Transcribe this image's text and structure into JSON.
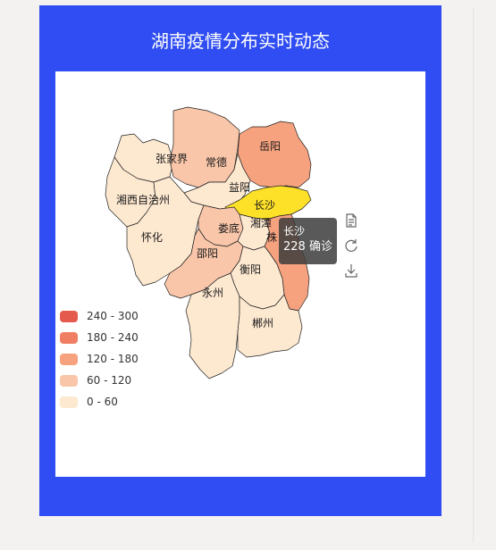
{
  "header": {
    "title": "湖南疫情分布实时动态"
  },
  "colors": {
    "card": "#2f4df2",
    "highlight": "#fde028"
  },
  "legend": {
    "items": [
      {
        "label": "240 - 300",
        "color": "#e45b4d"
      },
      {
        "label": "180 - 240",
        "color": "#ef7e62"
      },
      {
        "label": "120 - 180",
        "color": "#f6a27f"
      },
      {
        "label": "60 - 120",
        "color": "#f9c6a9"
      },
      {
        "label": "0 - 60",
        "color": "#fde8d0"
      }
    ]
  },
  "map": {
    "cities": {
      "zhangjiajie": "张家界",
      "changde": "常德",
      "yueyang": "岳阳",
      "yiyang": "益阳",
      "xiangxi": "湘西自治州",
      "changsha": "长沙",
      "huaihua": "怀化",
      "loudi": "娄底",
      "xiangtan": "湘潭",
      "zhuzhou": "株",
      "shaoyang": "邵阳",
      "hengyang": "衡阳",
      "yongzhou": "永州",
      "chenzhou": "郴州"
    }
  },
  "tooltip": {
    "city": "长沙",
    "value": "228 确诊"
  },
  "toolbox": {
    "icons": [
      "data-view-icon",
      "restore-icon",
      "save-image-icon"
    ]
  }
}
